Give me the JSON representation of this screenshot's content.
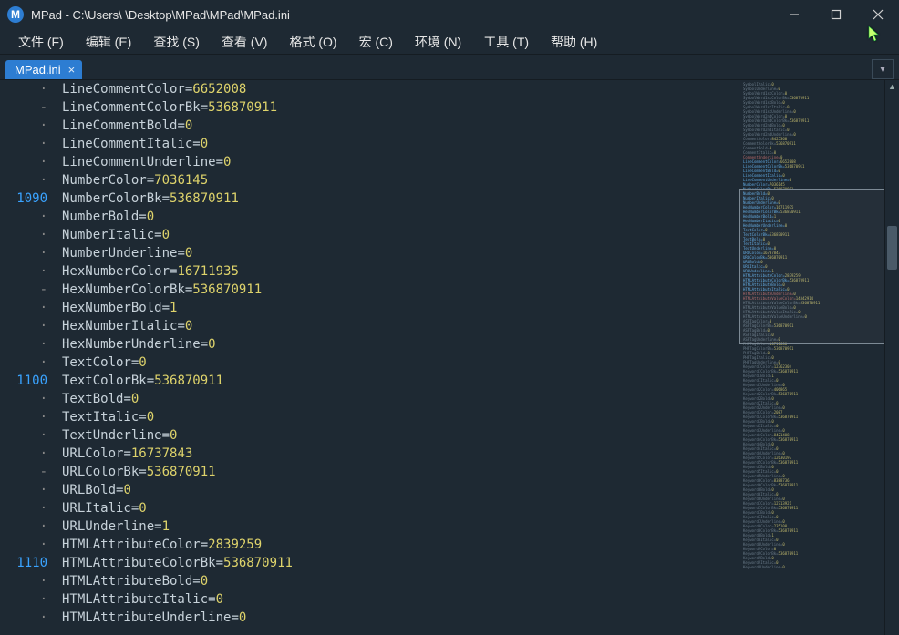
{
  "window": {
    "logo_letter": "M",
    "title": "MPad - C:\\Users\\    \\Desktop\\MPad\\MPad\\MPad.ini"
  },
  "menu": {
    "file": "文件 (F)",
    "edit": "编辑 (E)",
    "find": "查找 (S)",
    "view": "查看 (V)",
    "format": "格式 (O)",
    "macro": "宏 (C)",
    "env": "环境 (N)",
    "tools": "工具 (T)",
    "help": "帮助 (H)"
  },
  "tabs": {
    "active": "MPad.ini",
    "close_glyph": "×",
    "dropdown_glyph": "▾"
  },
  "gutter_rows": [
    "·",
    "-",
    "·",
    "·",
    "·",
    "·",
    "1090",
    "·",
    "·",
    "·",
    "·",
    "-",
    "·",
    "·",
    "·",
    "·",
    "1100",
    "·",
    "·",
    "·",
    "·",
    "-",
    "·",
    "·",
    "·",
    "·",
    "1110",
    "·",
    "·",
    "·"
  ],
  "code_lines": [
    {
      "key": "LineCommentColor",
      "value": "6652008"
    },
    {
      "key": "LineCommentColorBk",
      "value": "536870911"
    },
    {
      "key": "LineCommentBold",
      "value": "0"
    },
    {
      "key": "LineCommentItalic",
      "value": "0"
    },
    {
      "key": "LineCommentUnderline",
      "value": "0"
    },
    {
      "key": "NumberColor",
      "value": "7036145"
    },
    {
      "key": "NumberColorBk",
      "value": "536870911"
    },
    {
      "key": "NumberBold",
      "value": "0"
    },
    {
      "key": "NumberItalic",
      "value": "0"
    },
    {
      "key": "NumberUnderline",
      "value": "0"
    },
    {
      "key": "HexNumberColor",
      "value": "16711935"
    },
    {
      "key": "HexNumberColorBk",
      "value": "536870911"
    },
    {
      "key": "HexNumberBold",
      "value": "1"
    },
    {
      "key": "HexNumberItalic",
      "value": "0"
    },
    {
      "key": "HexNumberUnderline",
      "value": "0"
    },
    {
      "key": "TextColor",
      "value": "0"
    },
    {
      "key": "TextColorBk",
      "value": "536870911"
    },
    {
      "key": "TextBold",
      "value": "0"
    },
    {
      "key": "TextItalic",
      "value": "0"
    },
    {
      "key": "TextUnderline",
      "value": "0"
    },
    {
      "key": "URLColor",
      "value": "16737843"
    },
    {
      "key": "URLColorBk",
      "value": "536870911"
    },
    {
      "key": "URLBold",
      "value": "0"
    },
    {
      "key": "URLItalic",
      "value": "0"
    },
    {
      "key": "URLUnderline",
      "value": "1"
    },
    {
      "key": "HTMLAttributeColor",
      "value": "2839259"
    },
    {
      "key": "HTMLAttributeColorBk",
      "value": "536870911"
    },
    {
      "key": "HTMLAttributeBold",
      "value": "0"
    },
    {
      "key": "HTMLAttributeItalic",
      "value": "0"
    },
    {
      "key": "HTMLAttributeUnderline",
      "value": "0"
    }
  ],
  "minimap": [
    {
      "k": "SymbolItalic",
      "v": "0"
    },
    {
      "k": "SymbolUnderline",
      "v": "0"
    },
    {
      "k": "SymbolWord1stColor",
      "v": "0"
    },
    {
      "k": "SymbolWord1stColorBk",
      "v": "536870911"
    },
    {
      "k": "SymbolWord1stBold",
      "v": "0"
    },
    {
      "k": "SymbolWord1stItalic",
      "v": "0"
    },
    {
      "k": "SymbolWord1stUnderline",
      "v": "0"
    },
    {
      "k": "SymbolWord2ndColor",
      "v": "0"
    },
    {
      "k": "SymbolWord2ndColorBk",
      "v": "536870911"
    },
    {
      "k": "SymbolWord2ndBold",
      "v": "0"
    },
    {
      "k": "SymbolWord2ndItalic",
      "v": "0"
    },
    {
      "k": "SymbolWord2ndUnderline",
      "v": "0"
    },
    {
      "k": "CommentColor",
      "v": "8425360"
    },
    {
      "k": "CommentColorBk",
      "v": "536870911"
    },
    {
      "k": "CommentBold",
      "v": "0"
    },
    {
      "k": "CommentItalic",
      "v": "0"
    },
    {
      "k": "CommentUnderline",
      "v": "0",
      "cls": "mx"
    },
    {
      "k": "LineCommentColor",
      "v": "6652008",
      "cls": "mb"
    },
    {
      "k": "LineCommentColorBk",
      "v": "536870911",
      "cls": "mb"
    },
    {
      "k": "LineCommentBold",
      "v": "0",
      "cls": "mb"
    },
    {
      "k": "LineCommentItalic",
      "v": "0",
      "cls": "mb"
    },
    {
      "k": "LineCommentUnderline",
      "v": "0",
      "cls": "mb"
    },
    {
      "k": "NumberColor",
      "v": "7036145",
      "cls": "mb"
    },
    {
      "k": "NumberColorBk",
      "v": "536870911",
      "cls": "mb"
    },
    {
      "k": "NumberBold",
      "v": "0",
      "cls": "mb"
    },
    {
      "k": "NumberItalic",
      "v": "0",
      "cls": "mb"
    },
    {
      "k": "NumberUnderline",
      "v": "0",
      "cls": "mb"
    },
    {
      "k": "HexNumberColor",
      "v": "16711935",
      "cls": "mb"
    },
    {
      "k": "HexNumberColorBk",
      "v": "536870911",
      "cls": "mb"
    },
    {
      "k": "HexNumberBold",
      "v": "1",
      "cls": "mb"
    },
    {
      "k": "HexNumberItalic",
      "v": "0",
      "cls": "mb"
    },
    {
      "k": "HexNumberUnderline",
      "v": "0",
      "cls": "mb"
    },
    {
      "k": "TextColor",
      "v": "0",
      "cls": "mb"
    },
    {
      "k": "TextColorBk",
      "v": "536870911",
      "cls": "mb"
    },
    {
      "k": "TextBold",
      "v": "0",
      "cls": "mb"
    },
    {
      "k": "TextItalic",
      "v": "0",
      "cls": "mb"
    },
    {
      "k": "TextUnderline",
      "v": "0",
      "cls": "mb"
    },
    {
      "k": "URLColor",
      "v": "16737843",
      "cls": "mb"
    },
    {
      "k": "URLColorBk",
      "v": "536870911",
      "cls": "mb"
    },
    {
      "k": "URLBold",
      "v": "0",
      "cls": "mb"
    },
    {
      "k": "URLItalic",
      "v": "0",
      "cls": "mb"
    },
    {
      "k": "URLUnderline",
      "v": "1",
      "cls": "mb"
    },
    {
      "k": "HTMLAttributeColor",
      "v": "2839259",
      "cls": "mb"
    },
    {
      "k": "HTMLAttributeColorBk",
      "v": "536870911",
      "cls": "mb"
    },
    {
      "k": "HTMLAttributeBold",
      "v": "0",
      "cls": "mb"
    },
    {
      "k": "HTMLAttributeItalic",
      "v": "0",
      "cls": "mb"
    },
    {
      "k": "HTMLAttributeUnderline",
      "v": "0",
      "cls": "mx"
    },
    {
      "k": "HTMLAttributeValueColor",
      "v": "14342914",
      "cls": "mx"
    },
    {
      "k": "HTMLAttributeValueColorBk",
      "v": "536870911"
    },
    {
      "k": "HTMLAttributeValueBold",
      "v": "0"
    },
    {
      "k": "HTMLAttributeValueItalic",
      "v": "0"
    },
    {
      "k": "HTMLAttributeValueUnderline",
      "v": "0"
    },
    {
      "k": "ASPTagColor",
      "v": "0"
    },
    {
      "k": "ASPTagColorBk",
      "v": "536870911"
    },
    {
      "k": "ASPTagBold",
      "v": "0"
    },
    {
      "k": "ASPTagItalic",
      "v": "0"
    },
    {
      "k": "ASPTagUnderline",
      "v": "0"
    },
    {
      "k": "PHPTagColor",
      "v": "16711680"
    },
    {
      "k": "PHPTagColorBk",
      "v": "536870911"
    },
    {
      "k": "PHPTagBold",
      "v": "0"
    },
    {
      "k": "PHPTagItalic",
      "v": "0"
    },
    {
      "k": "PHPTagUnderline",
      "v": "0"
    },
    {
      "k": "Keyword1Color",
      "v": "12362304"
    },
    {
      "k": "Keyword1ColorBk",
      "v": "536870911"
    },
    {
      "k": "Keyword1Bold",
      "v": "1"
    },
    {
      "k": "Keyword1Italic",
      "v": "0"
    },
    {
      "k": "Keyword1Underline",
      "v": "0"
    },
    {
      "k": "Keyword2Color",
      "v": "406865"
    },
    {
      "k": "Keyword2ColorBk",
      "v": "536870911"
    },
    {
      "k": "Keyword2Bold",
      "v": "0"
    },
    {
      "k": "Keyword2Italic",
      "v": "0"
    },
    {
      "k": "Keyword2Underline",
      "v": "0"
    },
    {
      "k": "Keyword3Color",
      "v": "2087"
    },
    {
      "k": "Keyword3ColorBk",
      "v": "536870911"
    },
    {
      "k": "Keyword3Bold",
      "v": "0"
    },
    {
      "k": "Keyword3Italic",
      "v": "0"
    },
    {
      "k": "Keyword3Underline",
      "v": "0"
    },
    {
      "k": "Keyword4Color",
      "v": "8421408"
    },
    {
      "k": "Keyword4ColorBk",
      "v": "536870911"
    },
    {
      "k": "Keyword4Bold",
      "v": "0"
    },
    {
      "k": "Keyword4Italic",
      "v": "0"
    },
    {
      "k": "Keyword4Underline",
      "v": "0"
    },
    {
      "k": "Keyword5Color",
      "v": "12630197"
    },
    {
      "k": "Keyword5ColorBk",
      "v": "536870911"
    },
    {
      "k": "Keyword5Bold",
      "v": "0"
    },
    {
      "k": "Keyword5Italic",
      "v": "0"
    },
    {
      "k": "Keyword5Underline",
      "v": "0"
    },
    {
      "k": "Keyword6Color",
      "v": "8388736"
    },
    {
      "k": "Keyword6ColorBk",
      "v": "536870911"
    },
    {
      "k": "Keyword6Bold",
      "v": "0"
    },
    {
      "k": "Keyword6Italic",
      "v": "0"
    },
    {
      "k": "Keyword6Underline",
      "v": "0"
    },
    {
      "k": "Keyword7Color",
      "v": "12713921"
    },
    {
      "k": "Keyword7ColorBk",
      "v": "536870911"
    },
    {
      "k": "Keyword7Bold",
      "v": "0"
    },
    {
      "k": "Keyword7Italic",
      "v": "0"
    },
    {
      "k": "Keyword7Underline",
      "v": "0"
    },
    {
      "k": "Keyword8Color",
      "v": "235100"
    },
    {
      "k": "Keyword8ColorBk",
      "v": "536870911"
    },
    {
      "k": "Keyword8Bold",
      "v": "1"
    },
    {
      "k": "Keyword8Italic",
      "v": "0"
    },
    {
      "k": "Keyword8Underline",
      "v": "0"
    },
    {
      "k": "Keyword9Color",
      "v": "0"
    },
    {
      "k": "Keyword9ColorBk",
      "v": "536870911"
    },
    {
      "k": "Keyword9Bold",
      "v": "0"
    },
    {
      "k": "Keyword9Italic",
      "v": "0"
    },
    {
      "k": "Keyword9Underline",
      "v": "0"
    }
  ]
}
